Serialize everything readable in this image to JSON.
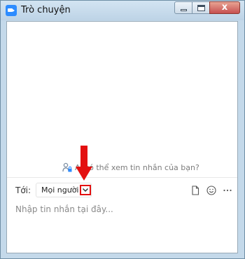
{
  "window": {
    "title": "Trò chuyện",
    "controls": [
      "minimize-icon",
      "maximize-icon",
      "close-icon"
    ],
    "close_glyph": "x"
  },
  "chat": {
    "privacy_notice": "Ai có thể xem tin nhắn của bạn?",
    "privacy_icon": "person-lock-icon"
  },
  "compose": {
    "to_label": "Tới:",
    "recipient": "Mọi người",
    "dropdown_icon": "chevron-down-icon",
    "tool_icons": [
      "file-icon",
      "emoji-icon",
      "more-icon"
    ],
    "message_placeholder": "Nhập tin nhắn tại đây..."
  },
  "annotation": {
    "arrow_color": "#e31010",
    "highlight_color": "#e31010"
  }
}
